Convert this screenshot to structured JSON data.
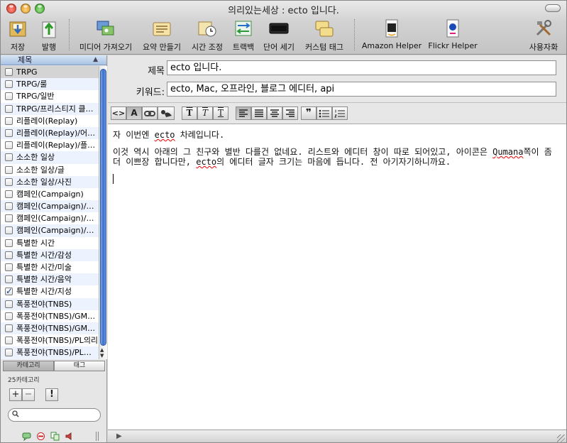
{
  "window": {
    "title": "의리있는세상 : ecto 입니다."
  },
  "toolbar": {
    "save": "저장",
    "publish": "발행",
    "media_import": "미디어 가져오기",
    "summary": "요약 만들기",
    "time_adjust": "시간 조정",
    "trackback": "트랙백",
    "word_count": "단어 세기",
    "custom_tags": "커스텀 태그",
    "amazon": "Amazon Helper",
    "flickr": "Flickr Helper",
    "dictionary": "사용자화"
  },
  "sidebar": {
    "header": "제목",
    "rows": [
      {
        "label": "TRPG",
        "checked": false
      },
      {
        "label": "TRPG/룰",
        "checked": false
      },
      {
        "label": "TRPG/일반",
        "checked": false
      },
      {
        "label": "TRPG/프리스티지 클…",
        "checked": false
      },
      {
        "label": "리플레이(Replay)",
        "checked": false
      },
      {
        "label": "리플레이(Replay)/어…",
        "checked": false
      },
      {
        "label": "리플레이(Replay)/플…",
        "checked": false
      },
      {
        "label": "소소한 일상",
        "checked": false
      },
      {
        "label": "소소한 일상/글",
        "checked": false
      },
      {
        "label": "소소한 일상/사진",
        "checked": false
      },
      {
        "label": "캠페인(Campaign)",
        "checked": false
      },
      {
        "label": "캠페인(Campaign)/…",
        "checked": false
      },
      {
        "label": "캠페인(Campaign)/…",
        "checked": false
      },
      {
        "label": "캠페인(Campaign)/…",
        "checked": false
      },
      {
        "label": "특별한 시간",
        "checked": false
      },
      {
        "label": "특별한 시간/감성",
        "checked": false
      },
      {
        "label": "특별한 시간/미술",
        "checked": false
      },
      {
        "label": "특별한 시간/음악",
        "checked": false
      },
      {
        "label": "특별한 시간/지성",
        "checked": true
      },
      {
        "label": "폭풍전야(TNBS)",
        "checked": false
      },
      {
        "label": "폭풍전야(TNBS)/GM…",
        "checked": false
      },
      {
        "label": "폭풍전야(TNBS)/GM…",
        "checked": false
      },
      {
        "label": "폭풍전야(TNBS)/PL의리",
        "checked": false
      },
      {
        "label": "폭풍전야(TNBS)/PL…",
        "checked": false
      }
    ],
    "tab_category": "카테고리",
    "tab_tags": "태그",
    "category_count": "25카테고리",
    "add": "+",
    "remove": "−",
    "alert": "!"
  },
  "editor": {
    "title_label": "제목",
    "title_value": "ecto 입니다.",
    "keywords_label": "키워드:",
    "keywords_value": "ecto, Mac, 오프라인, 블로그 에디터, api",
    "line1_pre": "자 이번엔 ",
    "line1_word": "ecto",
    "line1_post": " 차례입니다.",
    "line2_a": "이것 역시 아래의 그 친구와 별반 다를건 없네요. 리스트와 에디터 창이 따로 되어있고, 아이콘은 ",
    "line2_word1": "Qumana",
    "line2_b": "쪽이 좀 더 이쁘장 합니다만, ",
    "line2_word2": "ecto",
    "line2_c": "의 에디터 글자 크기는 마음에 듭니다. 전 아기자기하니까요."
  },
  "format": {
    "html": "<>",
    "font": "A",
    "bold_t": "T",
    "italic_t": "T",
    "under_t": "T",
    "quote": "❞"
  },
  "colors": {
    "accent": "#3b6fcd",
    "selection": "#d4d4d4"
  }
}
